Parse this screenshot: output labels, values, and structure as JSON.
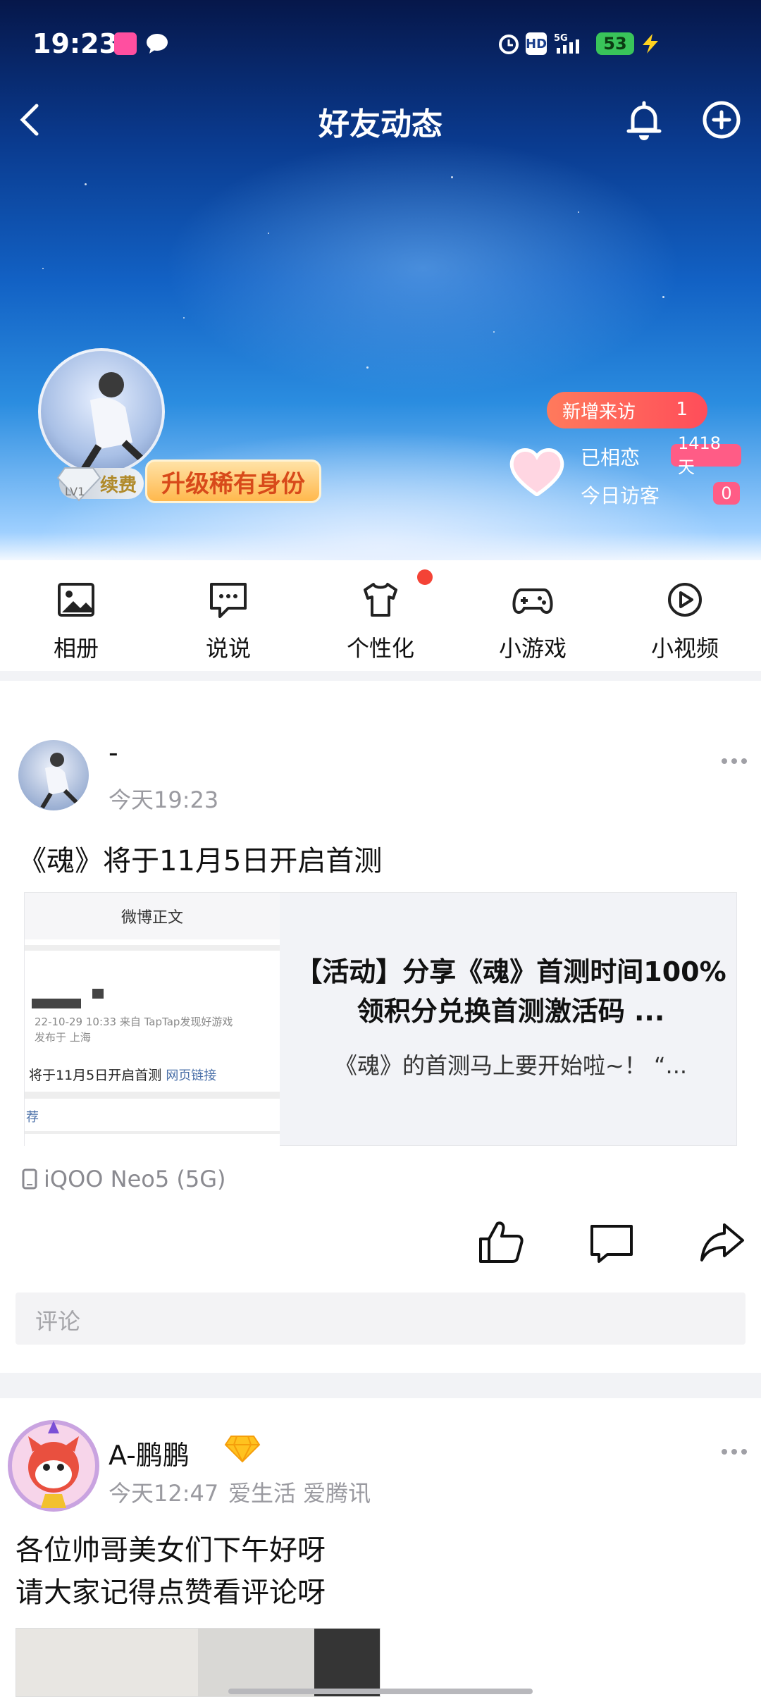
{
  "status_bar": {
    "time": "19:23",
    "battery": "53"
  },
  "header": {
    "title": "好友动态"
  },
  "profile": {
    "badge_renew": "续费",
    "badge_level": "LV1",
    "upgrade_label": "升级稀有身份",
    "new_visits_label": "新增来访",
    "new_visits_count": "1",
    "together_label": "已相恋",
    "together_days": "1418天",
    "today_visitors_label": "今日访客",
    "today_visitors_count": "0"
  },
  "functions": [
    {
      "label": "相册",
      "icon": "album-icon"
    },
    {
      "label": "说说",
      "icon": "message-icon"
    },
    {
      "label": "个性化",
      "icon": "shirt-icon"
    },
    {
      "label": "小游戏",
      "icon": "gamepad-icon"
    },
    {
      "label": "小视频",
      "icon": "play-icon"
    }
  ],
  "post1": {
    "author": "-",
    "time": "今天19:23",
    "text": "《魂》将于11月5日开启首测",
    "link_card": {
      "thumb_header": "微博正文",
      "thumb_meta": "22-10-29 10:33  来自 TapTap发现好游戏",
      "thumb_loc": "发布于 上海",
      "thumb_text": "将于11月5日开启首测",
      "thumb_link": "网页链接",
      "thumb_tag": "荐",
      "title": "【活动】分享《魂》首测时间100%领积分兑换首测激活码 ...",
      "desc": "《魂》的首测马上要开始啦~！ “..."
    },
    "device": "iQOO Neo5 (5G)",
    "comment_placeholder": "评论"
  },
  "post2": {
    "author": "A-鹏鹏",
    "time": "今天12:47",
    "tags": "爱生活 爱腾讯",
    "text_line1": "各位帅哥美女们下午好呀",
    "text_line2": "请大家记得点赞看评论呀"
  },
  "colors": {
    "accent_red": "#ff4d5a",
    "badge_pink": "#ff5c86",
    "gap": "#f2f3f6"
  }
}
